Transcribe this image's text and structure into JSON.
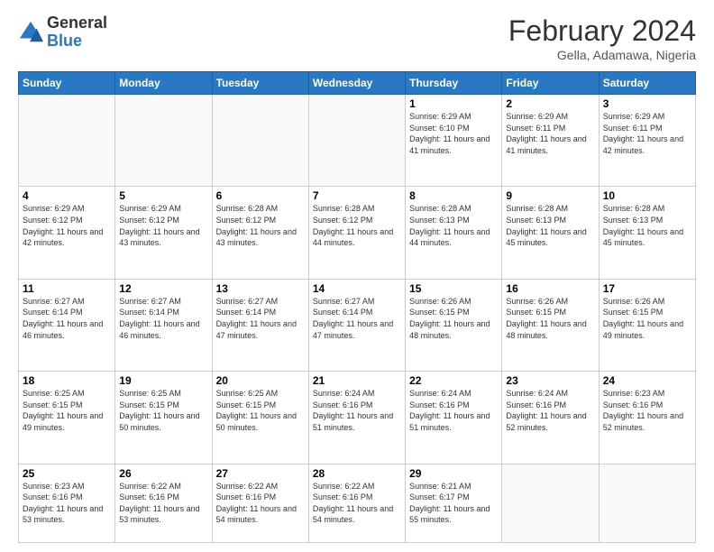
{
  "header": {
    "logo": {
      "general": "General",
      "blue": "Blue"
    },
    "title": "February 2024",
    "location": "Gella, Adamawa, Nigeria"
  },
  "days_of_week": [
    "Sunday",
    "Monday",
    "Tuesday",
    "Wednesday",
    "Thursday",
    "Friday",
    "Saturday"
  ],
  "weeks": [
    [
      {
        "day": "",
        "info": ""
      },
      {
        "day": "",
        "info": ""
      },
      {
        "day": "",
        "info": ""
      },
      {
        "day": "",
        "info": ""
      },
      {
        "day": "1",
        "info": "Sunrise: 6:29 AM\nSunset: 6:10 PM\nDaylight: 11 hours and 41 minutes."
      },
      {
        "day": "2",
        "info": "Sunrise: 6:29 AM\nSunset: 6:11 PM\nDaylight: 11 hours and 41 minutes."
      },
      {
        "day": "3",
        "info": "Sunrise: 6:29 AM\nSunset: 6:11 PM\nDaylight: 11 hours and 42 minutes."
      }
    ],
    [
      {
        "day": "4",
        "info": "Sunrise: 6:29 AM\nSunset: 6:12 PM\nDaylight: 11 hours and 42 minutes."
      },
      {
        "day": "5",
        "info": "Sunrise: 6:29 AM\nSunset: 6:12 PM\nDaylight: 11 hours and 43 minutes."
      },
      {
        "day": "6",
        "info": "Sunrise: 6:28 AM\nSunset: 6:12 PM\nDaylight: 11 hours and 43 minutes."
      },
      {
        "day": "7",
        "info": "Sunrise: 6:28 AM\nSunset: 6:12 PM\nDaylight: 11 hours and 44 minutes."
      },
      {
        "day": "8",
        "info": "Sunrise: 6:28 AM\nSunset: 6:13 PM\nDaylight: 11 hours and 44 minutes."
      },
      {
        "day": "9",
        "info": "Sunrise: 6:28 AM\nSunset: 6:13 PM\nDaylight: 11 hours and 45 minutes."
      },
      {
        "day": "10",
        "info": "Sunrise: 6:28 AM\nSunset: 6:13 PM\nDaylight: 11 hours and 45 minutes."
      }
    ],
    [
      {
        "day": "11",
        "info": "Sunrise: 6:27 AM\nSunset: 6:14 PM\nDaylight: 11 hours and 46 minutes."
      },
      {
        "day": "12",
        "info": "Sunrise: 6:27 AM\nSunset: 6:14 PM\nDaylight: 11 hours and 46 minutes."
      },
      {
        "day": "13",
        "info": "Sunrise: 6:27 AM\nSunset: 6:14 PM\nDaylight: 11 hours and 47 minutes."
      },
      {
        "day": "14",
        "info": "Sunrise: 6:27 AM\nSunset: 6:14 PM\nDaylight: 11 hours and 47 minutes."
      },
      {
        "day": "15",
        "info": "Sunrise: 6:26 AM\nSunset: 6:15 PM\nDaylight: 11 hours and 48 minutes."
      },
      {
        "day": "16",
        "info": "Sunrise: 6:26 AM\nSunset: 6:15 PM\nDaylight: 11 hours and 48 minutes."
      },
      {
        "day": "17",
        "info": "Sunrise: 6:26 AM\nSunset: 6:15 PM\nDaylight: 11 hours and 49 minutes."
      }
    ],
    [
      {
        "day": "18",
        "info": "Sunrise: 6:25 AM\nSunset: 6:15 PM\nDaylight: 11 hours and 49 minutes."
      },
      {
        "day": "19",
        "info": "Sunrise: 6:25 AM\nSunset: 6:15 PM\nDaylight: 11 hours and 50 minutes."
      },
      {
        "day": "20",
        "info": "Sunrise: 6:25 AM\nSunset: 6:15 PM\nDaylight: 11 hours and 50 minutes."
      },
      {
        "day": "21",
        "info": "Sunrise: 6:24 AM\nSunset: 6:16 PM\nDaylight: 11 hours and 51 minutes."
      },
      {
        "day": "22",
        "info": "Sunrise: 6:24 AM\nSunset: 6:16 PM\nDaylight: 11 hours and 51 minutes."
      },
      {
        "day": "23",
        "info": "Sunrise: 6:24 AM\nSunset: 6:16 PM\nDaylight: 11 hours and 52 minutes."
      },
      {
        "day": "24",
        "info": "Sunrise: 6:23 AM\nSunset: 6:16 PM\nDaylight: 11 hours and 52 minutes."
      }
    ],
    [
      {
        "day": "25",
        "info": "Sunrise: 6:23 AM\nSunset: 6:16 PM\nDaylight: 11 hours and 53 minutes."
      },
      {
        "day": "26",
        "info": "Sunrise: 6:22 AM\nSunset: 6:16 PM\nDaylight: 11 hours and 53 minutes."
      },
      {
        "day": "27",
        "info": "Sunrise: 6:22 AM\nSunset: 6:16 PM\nDaylight: 11 hours and 54 minutes."
      },
      {
        "day": "28",
        "info": "Sunrise: 6:22 AM\nSunset: 6:16 PM\nDaylight: 11 hours and 54 minutes."
      },
      {
        "day": "29",
        "info": "Sunrise: 6:21 AM\nSunset: 6:17 PM\nDaylight: 11 hours and 55 minutes."
      },
      {
        "day": "",
        "info": ""
      },
      {
        "day": "",
        "info": ""
      }
    ]
  ]
}
